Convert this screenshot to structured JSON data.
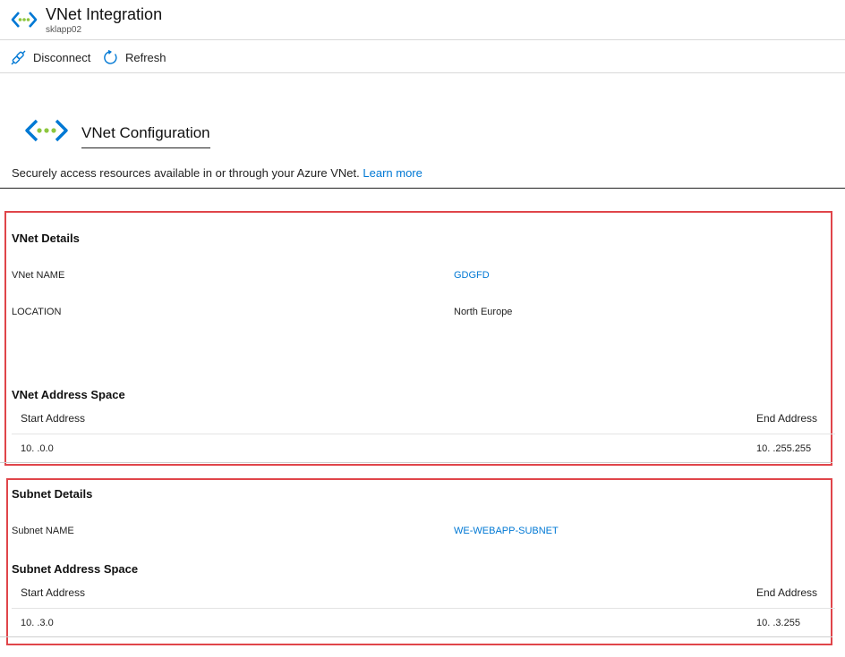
{
  "header": {
    "title": "VNet Integration",
    "subtitle": "sklapp02"
  },
  "toolbar": {
    "disconnect_label": "Disconnect",
    "refresh_label": "Refresh"
  },
  "config": {
    "title": "VNet Configuration",
    "description": "Securely access resources available in or through your Azure VNet.",
    "learn_more": "Learn more"
  },
  "vnet_details": {
    "title": "VNet Details",
    "name_label": "VNet NAME",
    "name_value": "GDGFD",
    "location_label": "LOCATION",
    "location_value": "North Europe"
  },
  "vnet_address_space": {
    "title": "VNet Address Space",
    "start_header": "Start Address",
    "end_header": "End Address",
    "start_value": "10.  .0.0",
    "end_value": "10.  .255.255"
  },
  "subnet_details": {
    "title": "Subnet Details",
    "name_label": "Subnet NAME",
    "name_value": "WE-WEBAPP-SUBNET"
  },
  "subnet_address_space": {
    "title": "Subnet Address Space",
    "start_header": "Start Address",
    "end_header": "End Address",
    "start_value": "10.  .3.0",
    "end_value": "10.  .3.255"
  },
  "colors": {
    "accent": "#0078d4",
    "highlight_border": "#e0454a",
    "icon_green": "#8dc63f",
    "icon_blue": "#0078d4"
  }
}
